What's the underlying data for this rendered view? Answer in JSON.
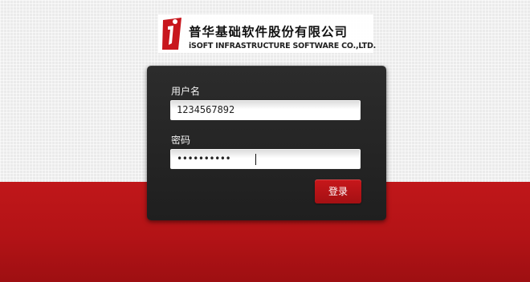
{
  "logo": {
    "company_name_cn": "普华基础软件股份有限公司",
    "company_name_en": "iSOFT INFRASTRUCTURE SOFTWARE CO.,LTD."
  },
  "login": {
    "username_label": "用户名",
    "username_value": "1234567892",
    "password_label": "密码",
    "password_masked": "••••••••••",
    "submit_label": "登录"
  },
  "colors": {
    "brand_red": "#b31316",
    "panel_dark": "#242424"
  }
}
